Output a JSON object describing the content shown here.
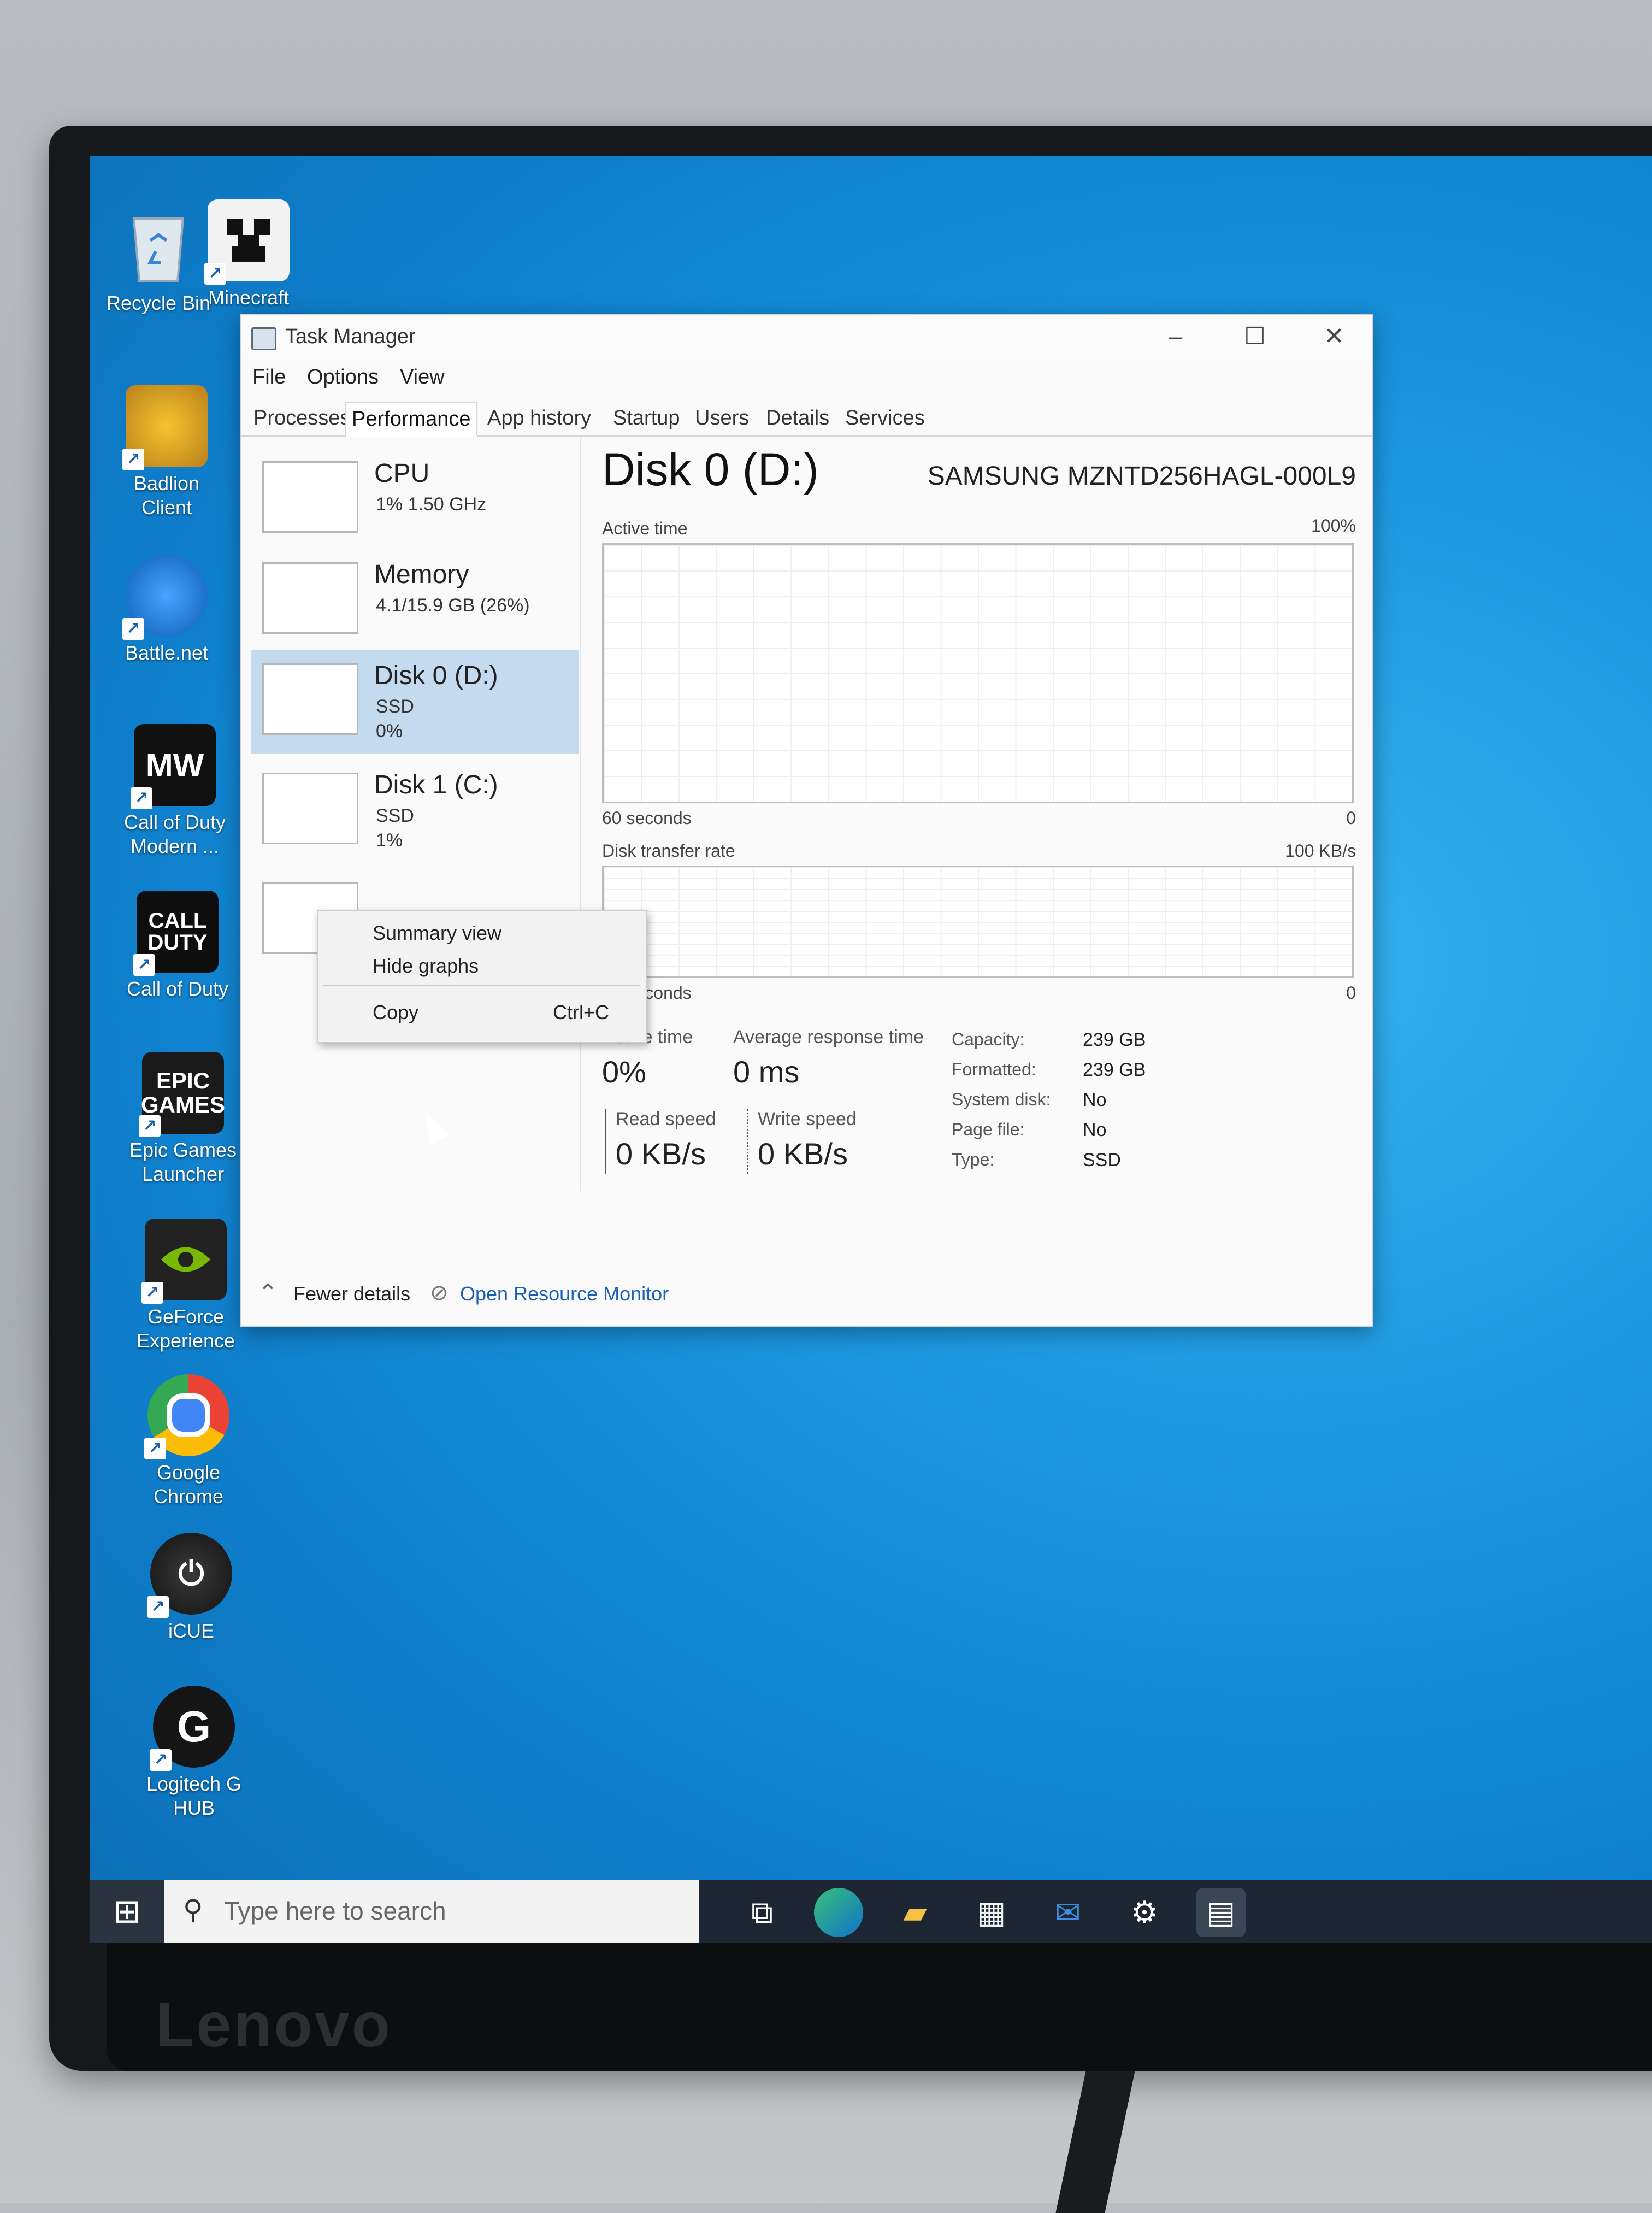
{
  "monitor": {
    "brand": "Lenovo"
  },
  "desktop": {
    "icons": [
      {
        "label": "Recycle Bin",
        "icon": "recycle-bin-icon"
      },
      {
        "label": "Minecraft",
        "icon": "minecraft-icon"
      },
      {
        "label": "Badlion\nClient",
        "icon": "badlion-icon"
      },
      {
        "label": "Battle.net",
        "icon": "battlenet-icon"
      },
      {
        "label": "Call of Duty\nModern ...",
        "icon": "cod-mw-icon"
      },
      {
        "label": "Call of Duty",
        "icon": "cod-icon"
      },
      {
        "label": "Epic Games\nLauncher",
        "icon": "epic-games-icon"
      },
      {
        "label": "GeForce\nExperience",
        "icon": "geforce-icon"
      },
      {
        "label": "Google\nChrome",
        "icon": "chrome-icon"
      },
      {
        "label": "iCUE",
        "icon": "icue-icon"
      },
      {
        "label": "Logitech G\nHUB",
        "icon": "logitech-icon"
      }
    ],
    "icon_text": {
      "mw": "MW",
      "cod": "CALL\nDUTY",
      "epic": "EPIC\nGAMES"
    }
  },
  "window": {
    "title": "Task Manager",
    "controls": {
      "minimize": "–",
      "maximize": "☐",
      "close": "✕"
    },
    "menu": [
      "File",
      "Options",
      "View"
    ],
    "tabs": [
      "Processes",
      "Performance",
      "App history",
      "Startup",
      "Users",
      "Details",
      "Services"
    ],
    "active_tab": "Performance"
  },
  "resources": [
    {
      "name": "CPU",
      "line1": "1%  1.50 GHz",
      "line2": ""
    },
    {
      "name": "Memory",
      "line1": "4.1/15.9 GB (26%)",
      "line2": ""
    },
    {
      "name": "Disk 0 (D:)",
      "line1": "SSD",
      "line2": "0%"
    },
    {
      "name": "Disk 1 (C:)",
      "line1": "SSD",
      "line2": "1%"
    }
  ],
  "context_menu": {
    "items": [
      "Summary view",
      "Hide graphs",
      "Copy"
    ],
    "shortcut": "Ctrl+C"
  },
  "detail": {
    "title": "Disk 0 (D:)",
    "model": "SAMSUNG MZNTD256HAGL-000L9",
    "graph1": {
      "label": "Active time",
      "max": "100%",
      "span": "60 seconds",
      "min": "0"
    },
    "graph2": {
      "label": "Disk transfer rate",
      "max": "100 KB/s",
      "span": "60 seconds",
      "min": "0"
    },
    "stats": {
      "active_time_label": "Active time",
      "active_time": "0%",
      "avg_resp_label": "Average response time",
      "avg_resp": "0 ms",
      "read_label": "Read speed",
      "read": "0 KB/s",
      "write_label": "Write speed",
      "write": "0 KB/s"
    },
    "props": [
      {
        "k": "Capacity:",
        "v": "239 GB"
      },
      {
        "k": "Formatted:",
        "v": "239 GB"
      },
      {
        "k": "System disk:",
        "v": "No"
      },
      {
        "k": "Page file:",
        "v": "No"
      },
      {
        "k": "Type:",
        "v": "SSD"
      }
    ]
  },
  "footer": {
    "fewer": "Fewer details",
    "monitor": "Open Resource Monitor"
  },
  "taskbar": {
    "search_placeholder": "Type here to search",
    "icons": [
      "task-view-icon",
      "edge-icon",
      "file-explorer-icon",
      "store-icon",
      "mail-icon",
      "settings-icon",
      "task-manager-icon"
    ]
  },
  "colors": {
    "desktop": "#1c98e1",
    "selected": "#c4dbef",
    "link": "#1a5fb4"
  }
}
